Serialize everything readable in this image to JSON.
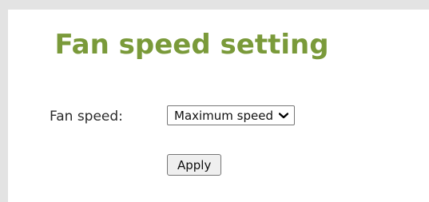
{
  "page": {
    "title": "Fan speed setting"
  },
  "form": {
    "fan_speed_label": "Fan speed:",
    "fan_speed_selected": "Maximum speed",
    "apply_label": "Apply"
  },
  "icons": {
    "dropdown": "chevron-down-icon"
  },
  "colors": {
    "title": "#7a9a3a",
    "frame_border": "#e3e3e3",
    "control_border": "#767676",
    "button_bg": "#efefef"
  }
}
